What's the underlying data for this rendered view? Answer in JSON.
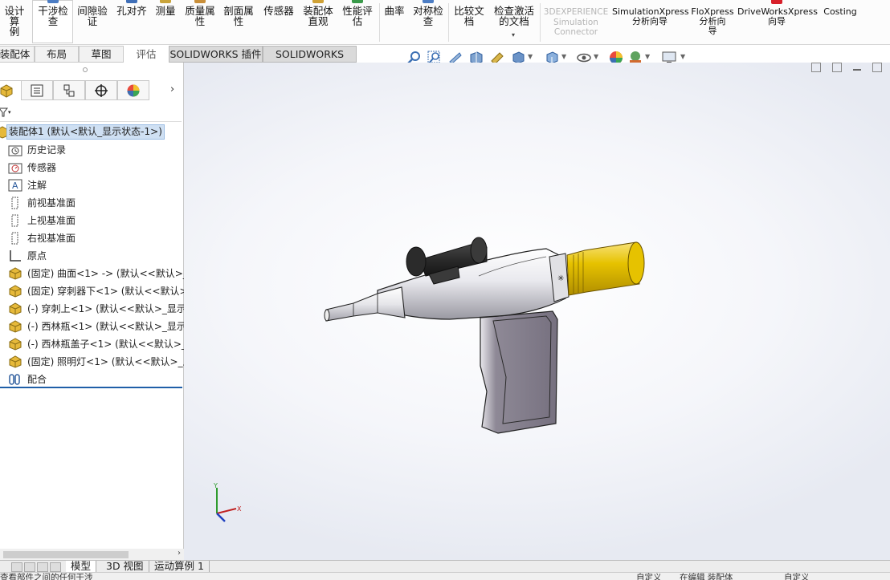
{
  "ribbon": {
    "buttons": [
      {
        "label": "设计算\n例"
      },
      {
        "label": "干涉检\n查"
      },
      {
        "label": "间隙验\n证"
      },
      {
        "label": "孔对齐"
      },
      {
        "label": "测量"
      },
      {
        "label": "质量属\n性"
      },
      {
        "label": "剖面属\n性"
      },
      {
        "label": "传感器"
      },
      {
        "label": "装配体\n直观"
      },
      {
        "label": "性能评\n估"
      },
      {
        "label": "曲率"
      },
      {
        "label": "对称检\n查"
      },
      {
        "label": "比较文\n档"
      },
      {
        "label": "检查激活\n的文档"
      },
      {
        "label": "3DEXPERIENCE\nSimulation\nConnector"
      },
      {
        "label": "SimulationXpress\n分析向导"
      },
      {
        "label": "FloXpress\n分析向\n导"
      },
      {
        "label": "DriveWorksXpress\n向导"
      },
      {
        "label": "Costing"
      }
    ]
  },
  "tabs": [
    "装配体",
    "布局",
    "草图",
    "评估",
    "SOLIDWORKS 插件",
    "SOLIDWORKS MBD"
  ],
  "tree": {
    "root": "装配体1  (默认<默认_显示状态-1>)",
    "items": [
      {
        "label": "历史记录",
        "icon": "history-folder-icon"
      },
      {
        "label": "传感器",
        "icon": "sensor-icon"
      },
      {
        "label": "注解",
        "icon": "annotation-icon"
      },
      {
        "label": "前视基准面",
        "icon": "plane-icon"
      },
      {
        "label": "上视基准面",
        "icon": "plane-icon"
      },
      {
        "label": "右视基准面",
        "icon": "plane-icon"
      },
      {
        "label": "原点",
        "icon": "origin-icon"
      },
      {
        "label": "(固定) 曲面<1> -> (默认<<默认>_",
        "icon": "part-icon"
      },
      {
        "label": "(固定) 穿刺器下<1> (默认<<默认>_",
        "icon": "part-icon"
      },
      {
        "label": "(-) 穿刺上<1> (默认<<默认>_显示",
        "icon": "part-icon"
      },
      {
        "label": "(-) 西林瓶<1> (默认<<默认>_显示",
        "icon": "part-icon"
      },
      {
        "label": "(-) 西林瓶盖子<1> (默认<<默认>_显",
        "icon": "part-icon"
      },
      {
        "label": "(固定) 照明灯<1> (默认<<默认>_显",
        "icon": "part-icon"
      },
      {
        "label": "配合",
        "icon": "mates-icon"
      }
    ]
  },
  "bottom_tabs": [
    "模型",
    "3D 视图",
    "运动算例 1"
  ],
  "status": {
    "left": "查看部件之间的任何干涉",
    "mid": "自定义",
    "edit": "在编辑 装配体",
    "right": "自定义"
  },
  "colors": {
    "accent": "#1f5fa8",
    "gun_body": "#f2f2f4",
    "grip": "#7f7a88",
    "cylinder": "#e6c200",
    "black_part": "#2b2b2b"
  }
}
